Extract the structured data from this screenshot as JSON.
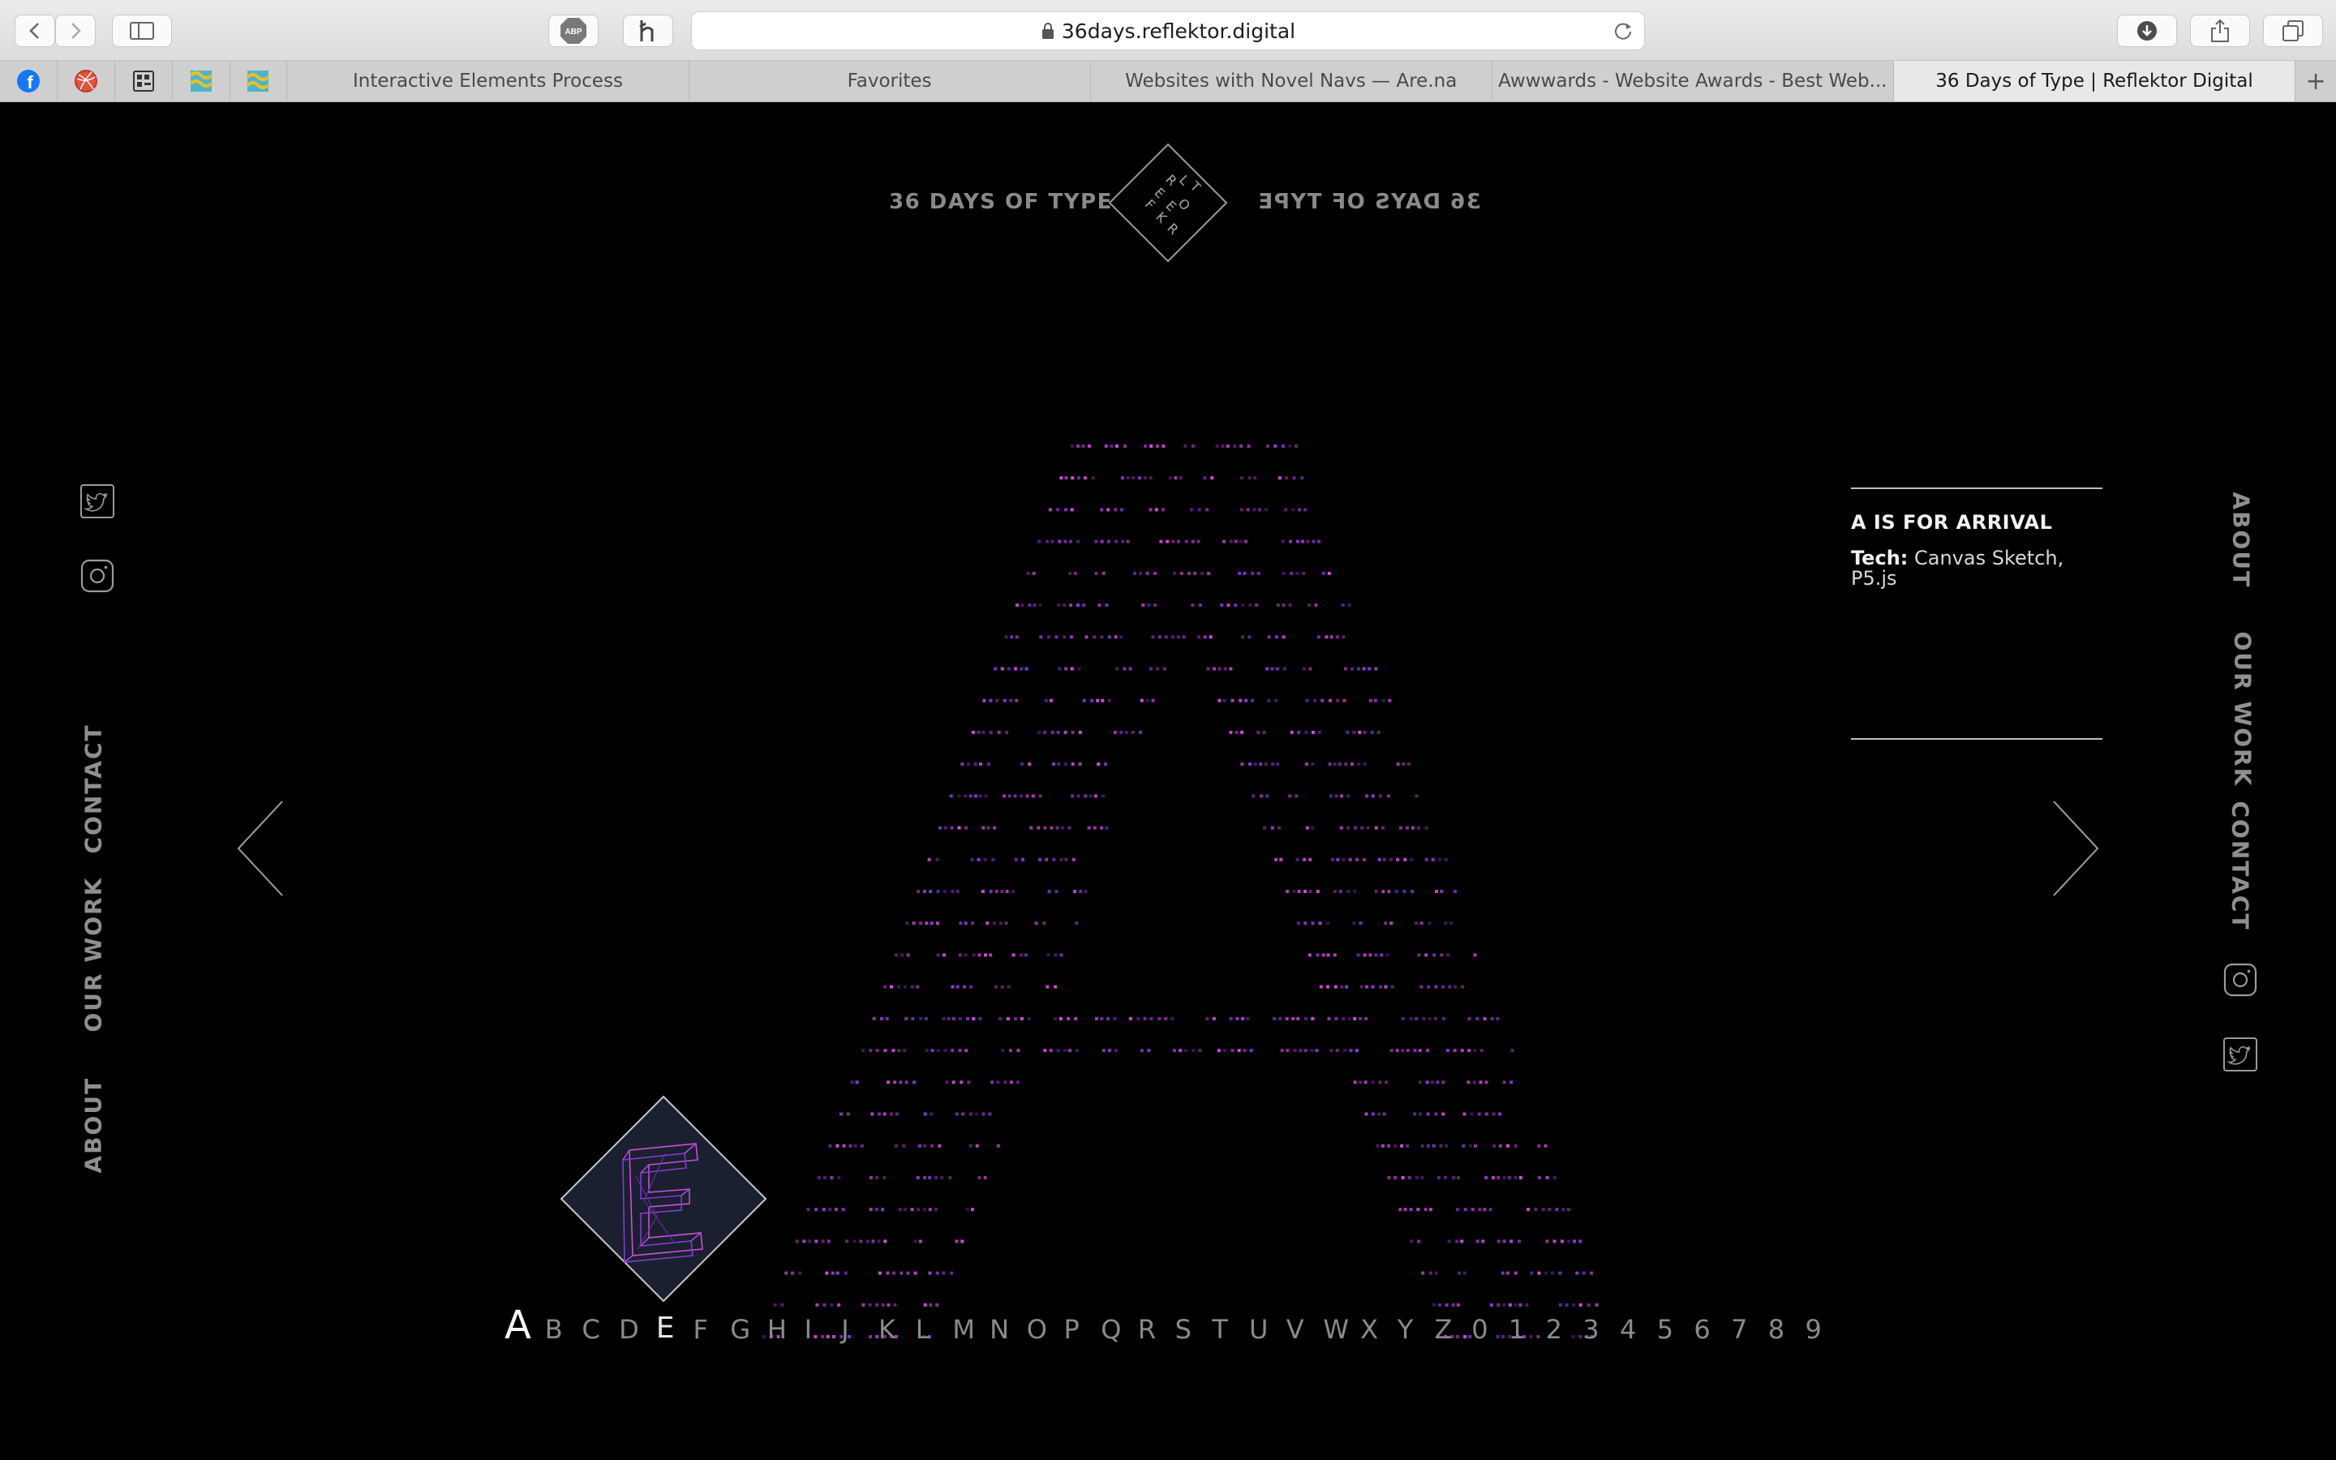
{
  "browser": {
    "url": "36days.reflektor.digital",
    "tabs": [
      {
        "label": "Interactive Elements Process",
        "active": false
      },
      {
        "label": "Favorites",
        "active": false
      },
      {
        "label": "Websites with Novel Navs — Are.na",
        "active": false
      },
      {
        "label": "Awwwards - Website Awards - Best Web...",
        "active": false
      },
      {
        "label": "36 Days of Type | Reflektor Digital",
        "active": true
      }
    ],
    "new_tab_label": "+"
  },
  "header": {
    "left_text": "36 DAYS OF TYPE",
    "right_text": "36 DAYS OF TYPE",
    "logo_letters": [
      "R",
      "L",
      "T",
      "E",
      "O",
      "E",
      "F",
      "K",
      "R"
    ]
  },
  "left_nav": {
    "contact": "CONTACT",
    "our_work": "OUR WORK",
    "about": "ABOUT"
  },
  "right_nav": {
    "about": "ABOUT",
    "our_work": "OUR WORK",
    "contact": "CONTACT"
  },
  "info": {
    "title": "A IS FOR ARRIVAL",
    "tech_label": "Tech:",
    "tech_value": "Canvas Sketch, P5.js"
  },
  "preview_letter": "E",
  "alphabet": [
    "A",
    "B",
    "C",
    "D",
    "E",
    "F",
    "G",
    "H",
    "I",
    "J",
    "K",
    "L",
    "M",
    "N",
    "O",
    "P",
    "Q",
    "R",
    "S",
    "T",
    "U",
    "V",
    "W",
    "X",
    "Y",
    "Z",
    "0",
    "1",
    "2",
    "3",
    "4",
    "5",
    "6",
    "7",
    "8",
    "9"
  ],
  "alphabet_current": "A",
  "alphabet_hovered": "E",
  "colors": {
    "accent_magenta": "#d64fe0",
    "accent_purple": "#8a3ad8",
    "background": "#000000",
    "nav_gray": "#8f8f8f"
  }
}
